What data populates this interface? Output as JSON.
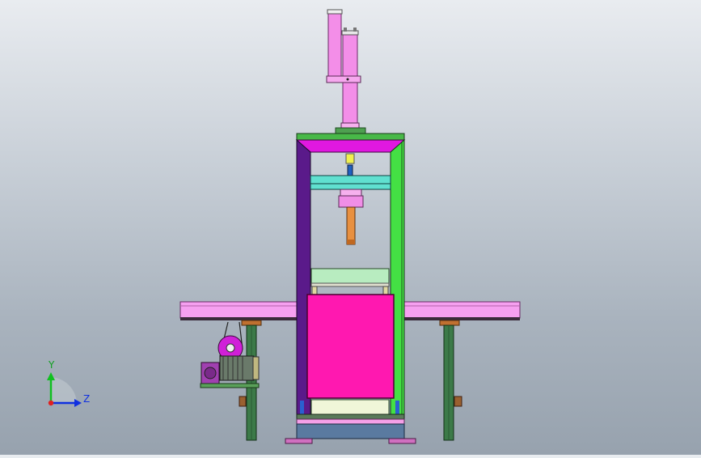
{
  "viewport": {
    "triad": {
      "y_label": "Y",
      "z_label": "Z",
      "y_color": "#10c020",
      "z_color": "#1030e0",
      "origin_color": "#e02020"
    }
  },
  "colors": {
    "background_top": "#e9ecf0",
    "background_bottom": "#97a2ae",
    "cylinder": "#f08ee6",
    "frame_top": "#e018e0",
    "frame_left": "#5a1a8a",
    "frame_right": "#40e040",
    "platen": "#ff18b0",
    "conveyor": "#f6a0f0",
    "leg": "#3c7a48",
    "motor": "#708070",
    "base": "#5a7aa0"
  }
}
